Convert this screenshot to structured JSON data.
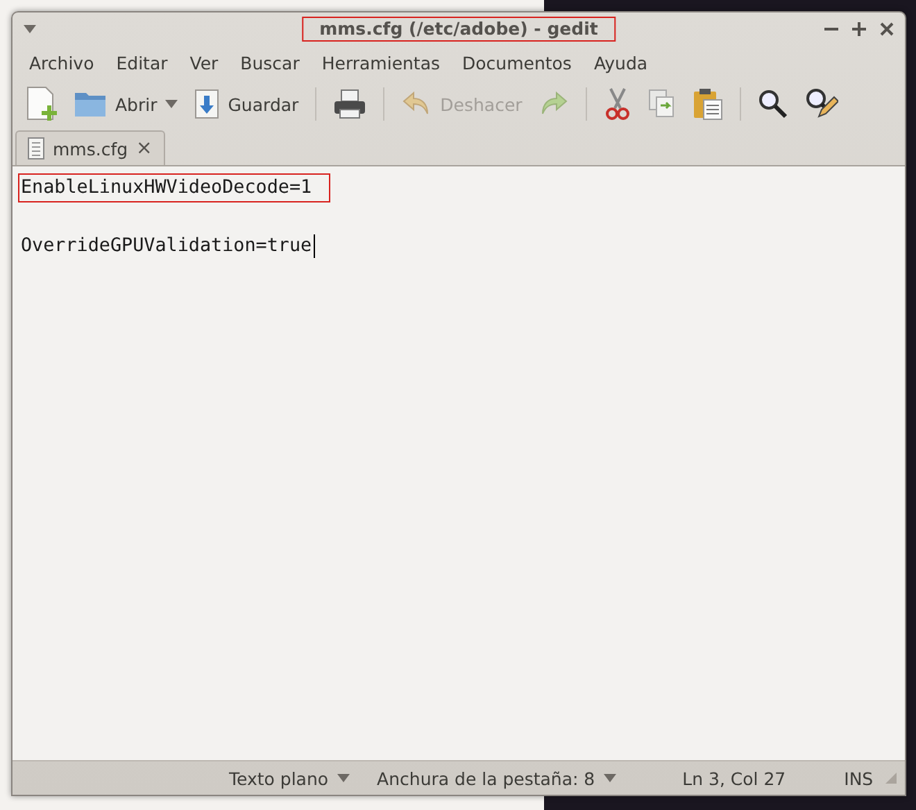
{
  "window": {
    "title": "mms.cfg (/etc/adobe) - gedit",
    "title_highlighted": true
  },
  "menu": [
    "Archivo",
    "Editar",
    "Ver",
    "Buscar",
    "Herramientas",
    "Documentos",
    "Ayuda"
  ],
  "toolbar": [
    {
      "disabled": false
    },
    {
      "label": "Abrir",
      "disabled": false,
      "dropdown": true
    },
    {
      "label": "Guardar",
      "disabled": false
    },
    {
      "disabled": false
    },
    {
      "label": "Deshacer",
      "disabled": true
    },
    {
      "disabled": true
    },
    {
      "disabled": false
    },
    {
      "disabled": false
    },
    {
      "disabled": false
    },
    {
      "disabled": false
    },
    {
      "disabled": false
    }
  ],
  "tabs": [
    {
      "label": "mms.cfg",
      "selected": true,
      "close": "×"
    }
  ],
  "editor": {
    "lines": [
      {
        "text": "EnableLinuxHWVideoDecode=1",
        "highlighted": true
      },
      {
        "highlighted": false
      },
      {
        "text": "OverrideGPUValidation=true",
        "highlighted": false,
        "cursor": true
      }
    ]
  },
  "status_bar": {
    "language": "Texto plano",
    "tab_width": "Anchura de la pestaña: 8",
    "position": "Ln 3, Col 27",
    "mode": "INS"
  }
}
